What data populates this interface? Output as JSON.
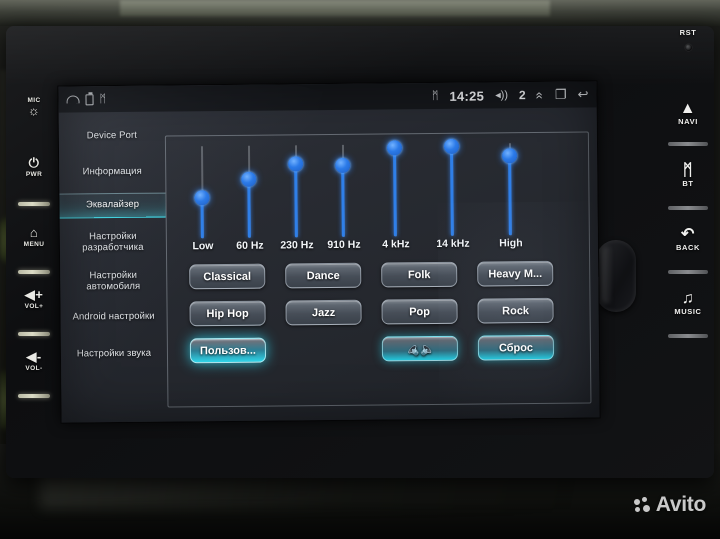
{
  "device": {
    "left_buttons": [
      {
        "label": "MIC",
        "icon": "microphone-icon",
        "glyph": "ප"
      },
      {
        "label": "PWR",
        "icon": "power-icon",
        "glyph": "⏻"
      },
      {
        "label": "MENU",
        "icon": "home-icon",
        "glyph": "⌂"
      },
      {
        "label": "VOL+",
        "icon": "volume-up-icon",
        "glyph": "◂+"
      },
      {
        "label": "VOL-",
        "icon": "volume-down-icon",
        "glyph": "◂-"
      }
    ],
    "right_buttons": [
      {
        "label": "RST",
        "icon": "reset-pinhole-icon",
        "glyph": ""
      },
      {
        "label": "NAVI",
        "icon": "navigation-icon",
        "glyph": "▲"
      },
      {
        "label": "BT",
        "icon": "bluetooth-icon",
        "glyph": "ᛗ"
      },
      {
        "label": "BACK",
        "icon": "back-arrow-icon",
        "glyph": "↶"
      },
      {
        "label": "MUSIC",
        "icon": "music-note-icon",
        "glyph": "♫"
      }
    ]
  },
  "statusbar": {
    "left_icons": [
      {
        "name": "notification-home-icon"
      },
      {
        "name": "battery-icon"
      },
      {
        "name": "usb-icon",
        "glyph": "ᛗ"
      }
    ],
    "bluetooth_icon": "ᛗ",
    "clock": "14:25",
    "volume_icon": "◂))",
    "volume_level": "2",
    "nav_expand": "«",
    "nav_recents": "❐",
    "nav_back": "↩"
  },
  "sidebar": {
    "items": [
      {
        "label": "Device Port",
        "selected": false
      },
      {
        "label": "Информация",
        "selected": false
      },
      {
        "label": "Эквалайзер",
        "selected": true
      },
      {
        "label": "Настройки разработчика",
        "selected": false
      },
      {
        "label": "Настройки автомобиля",
        "selected": false
      },
      {
        "label": "Android настройки",
        "selected": false
      },
      {
        "label": "Настройки звука",
        "selected": false
      }
    ]
  },
  "equalizer": {
    "accent_color": "#2f7fe8",
    "bands": [
      {
        "label": "Low",
        "value": 42
      },
      {
        "label": "60 Hz",
        "value": 62
      },
      {
        "label": "230 Hz",
        "value": 78
      },
      {
        "label": "910 Hz",
        "value": 76
      },
      {
        "label": "4 kHz",
        "value": 96
      },
      {
        "label": "14 kHz",
        "value": 97
      },
      {
        "label": "High",
        "value": 88
      }
    ]
  },
  "presets": {
    "buttons": [
      {
        "label": "Classical",
        "state": "normal"
      },
      {
        "label": "Dance",
        "state": "normal"
      },
      {
        "label": "Folk",
        "state": "normal"
      },
      {
        "label": "Heavy M...",
        "state": "normal"
      },
      {
        "label": "Hip Hop",
        "state": "normal"
      },
      {
        "label": "Jazz",
        "state": "normal"
      },
      {
        "label": "Pop",
        "state": "normal"
      },
      {
        "label": "Rock",
        "state": "normal"
      },
      {
        "label": "Пользов...",
        "state": "selected"
      },
      {
        "label": "",
        "state": "glow",
        "icon": "balance-fader-icon"
      },
      {
        "label": "Сброс",
        "state": "glow"
      }
    ]
  },
  "watermark": {
    "text": "Avito"
  }
}
